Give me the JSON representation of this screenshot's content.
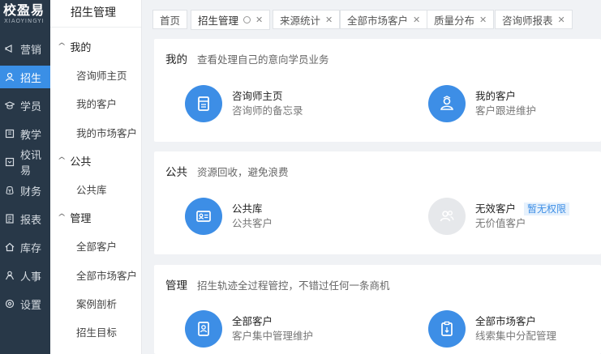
{
  "brand": {
    "name": "校盈易",
    "sub": "XIAOYINGYI"
  },
  "nav": [
    {
      "label": "营销",
      "icon": "marketing-icon",
      "active": false
    },
    {
      "label": "招生",
      "icon": "user-icon",
      "active": true
    },
    {
      "label": "学员",
      "icon": "graduation-cap-icon",
      "active": false
    },
    {
      "label": "教学",
      "icon": "book-icon",
      "active": false
    },
    {
      "label": "校讯易",
      "icon": "message-icon",
      "active": false
    },
    {
      "label": "财务",
      "icon": "money-icon",
      "active": false
    },
    {
      "label": "报表",
      "icon": "report-icon",
      "active": false
    },
    {
      "label": "库存",
      "icon": "home-icon",
      "active": false
    },
    {
      "label": "人事",
      "icon": "person-icon",
      "active": false
    },
    {
      "label": "设置",
      "icon": "gear-icon",
      "active": false
    }
  ],
  "sidebar": {
    "title": "招生管理",
    "groups": [
      {
        "label": "我的",
        "items": [
          "咨询师主页",
          "我的客户",
          "我的市场客户"
        ]
      },
      {
        "label": "公共",
        "items": [
          "公共库"
        ]
      },
      {
        "label": "管理",
        "items": [
          "全部客户",
          "全部市场客户",
          "案例剖析",
          "招生目标"
        ]
      }
    ]
  },
  "tabs": [
    {
      "label": "首页",
      "closable": false,
      "active": false
    },
    {
      "label": "招生管理",
      "closable": true,
      "active": true
    },
    {
      "label": "来源统计",
      "closable": true,
      "active": false
    },
    {
      "label": "全部市场客户",
      "closable": true,
      "active": false
    },
    {
      "label": "质量分布",
      "closable": true,
      "active": false
    },
    {
      "label": "咨询师报表",
      "closable": true,
      "active": false
    }
  ],
  "sections": [
    {
      "title": "我的",
      "desc": "查看处理自己的意向学员业务",
      "cards": [
        {
          "title": "咨询师主页",
          "desc": "咨询师的备忘录",
          "icon": "notebook-icon",
          "enabled": true
        },
        {
          "title": "我的客户",
          "desc": "客户跟进维护",
          "icon": "customer-icon",
          "enabled": true
        }
      ]
    },
    {
      "title": "公共",
      "desc": "资源回收，避免浪费",
      "cards": [
        {
          "title": "公共库",
          "desc": "公共客户",
          "icon": "contact-card-icon",
          "enabled": true
        },
        {
          "title": "无效客户",
          "desc": "无价值客户",
          "icon": "users-group-icon",
          "enabled": false,
          "badge": "暂无权限"
        }
      ]
    },
    {
      "title": "管理",
      "desc": "招生轨迹全过程管控，不错过任何一条商机",
      "cards": [
        {
          "title": "全部客户",
          "desc": "客户集中管理维护",
          "icon": "person-list-icon",
          "enabled": true
        },
        {
          "title": "全部市场客户",
          "desc": "线索集中分配管理",
          "icon": "clipboard-icon",
          "enabled": true
        }
      ]
    }
  ],
  "colors": {
    "accent": "#3d8ee6",
    "nav_bg": "#283848",
    "disabled": "#e6e8eb"
  }
}
